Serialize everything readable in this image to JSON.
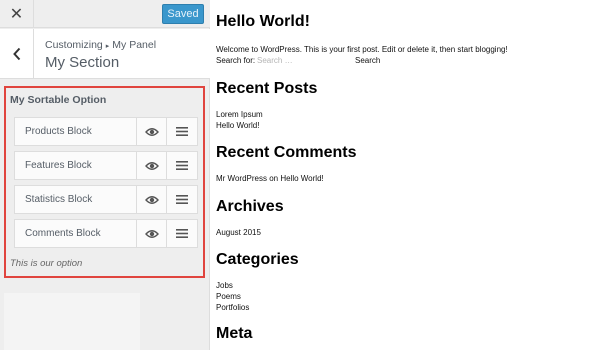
{
  "topbar": {
    "close_label": "✕",
    "saved_label": "Saved"
  },
  "section_header": {
    "breadcrumb_root": "Customizing",
    "breadcrumb_separator": "▸",
    "breadcrumb_panel": "My Panel",
    "title": "My Section"
  },
  "control": {
    "title": "My Sortable Option",
    "items": [
      {
        "label": "Products Block"
      },
      {
        "label": "Features Block"
      },
      {
        "label": "Statistics Block"
      },
      {
        "label": "Comments Block"
      }
    ],
    "description": "This is our option"
  },
  "preview": {
    "title": "Hello World!",
    "intro": "Welcome to WordPress. This is your first post. Edit or delete it, then start blogging!",
    "search": {
      "label": "Search for:",
      "placeholder": "Search …",
      "button": "Search"
    },
    "recent_posts": {
      "heading": "Recent Posts",
      "items": [
        "Lorem Ipsum",
        "Hello World!"
      ]
    },
    "recent_comments": {
      "heading": "Recent Comments",
      "items": [
        "Mr WordPress on Hello World!"
      ]
    },
    "archives": {
      "heading": "Archives",
      "items": [
        "August 2015"
      ]
    },
    "categories": {
      "heading": "Categories",
      "items": [
        "Jobs",
        "Poems",
        "Portfolios"
      ]
    },
    "meta": {
      "heading": "Meta"
    }
  },
  "colors": {
    "accent": "#3a97cc",
    "highlight_border": "#e0443e",
    "panel_bg": "#eeeeee"
  },
  "icons": {
    "close": "close-icon",
    "back": "chevron-left-icon",
    "visibility": "eye-icon",
    "drag": "drag-handle-icon"
  }
}
